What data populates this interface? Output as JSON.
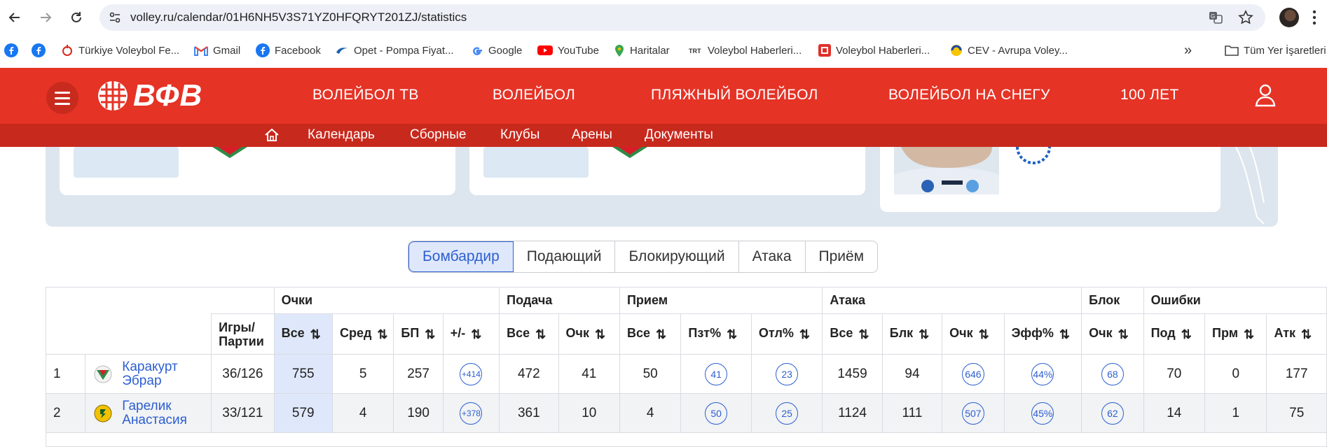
{
  "browser": {
    "url": "volley.ru/calendar/01H6NH5V3S71YZ0HFQRYT201ZJ/statistics",
    "bookmarks": [
      {
        "label": "",
        "icon": "facebook-icon"
      },
      {
        "label": "",
        "icon": "facebook-icon"
      },
      {
        "label": "Türkiye Voleybol Fe...",
        "icon": "tvf-icon"
      },
      {
        "label": "Gmail",
        "icon": "gmail-icon"
      },
      {
        "label": "Facebook",
        "icon": "facebook-icon"
      },
      {
        "label": "Opet - Pompa Fiyat...",
        "icon": "opet-icon"
      },
      {
        "label": "Google",
        "icon": "google-icon"
      },
      {
        "label": "YouTube",
        "icon": "youtube-icon"
      },
      {
        "label": "Haritalar",
        "icon": "maps-icon"
      },
      {
        "label": "Voleybol Haberleri...",
        "icon": "trt-icon"
      },
      {
        "label": "Voleybol Haberleri...",
        "icon": "news-icon"
      },
      {
        "label": "CEV - Avrupa Voley...",
        "icon": "cev-icon"
      }
    ],
    "overflow_label": "»",
    "all_bookmarks_label": "Tüm Yer İşaretleri"
  },
  "site": {
    "logo_text": "ВФВ",
    "nav": [
      "ВОЛЕЙБОЛ ТВ",
      "ВОЛЕЙБОЛ",
      "ПЛЯЖНЫЙ ВОЛЕЙБОЛ",
      "ВОЛЕЙБОЛ НА СНЕГУ",
      "100 ЛЕТ"
    ],
    "subnav": [
      "Календарь",
      "Сборные",
      "Клубы",
      "Арены",
      "Документы"
    ],
    "brand_color": "#e53326",
    "subnav_color": "#c8291d",
    "accent_color": "#2d5fd0"
  },
  "tabs": {
    "items": [
      "Бомбардир",
      "Подающий",
      "Блокирующий",
      "Атака",
      "Приём"
    ],
    "active": "Бомбардир"
  },
  "table": {
    "groups": {
      "points": "Очки",
      "serve": "Подача",
      "reception": "Прием",
      "attack": "Атака",
      "block": "Блок",
      "errors": "Ошибки"
    },
    "columns": {
      "games": "Игры/ Партии",
      "pts_all": "Все",
      "pts_avg": "Сред",
      "pts_bp": "БП",
      "pts_pm": "+/-",
      "srv_all": "Все",
      "srv_pts": "Очк",
      "rec_all": "Все",
      "rec_pos": "Пзт%",
      "rec_exc": "Отл%",
      "atk_all": "Все",
      "atk_blk": "Блк",
      "atk_pts": "Очк",
      "atk_eff": "Эфф%",
      "blk_pts": "Очк",
      "err_srv": "Под",
      "err_rec": "Прм",
      "err_atk": "Атк"
    },
    "rows": [
      {
        "rank": "1",
        "name": "Каракурт Эбрар",
        "club_icon": "lokomotiv-logo",
        "games": "36/126",
        "pts_all": "755",
        "pts_avg": "5",
        "pts_bp": "257",
        "pts_pm": "+414",
        "srv_all": "472",
        "srv_pts": "41",
        "rec_all": "50",
        "rec_pos": "41",
        "rec_exc": "23",
        "atk_all": "1459",
        "atk_blk": "94",
        "atk_pts": "646",
        "atk_eff": "44%",
        "blk_pts": "68",
        "err_srv": "70",
        "err_rec": "0",
        "err_atk": "177"
      },
      {
        "rank": "2",
        "name": "Гарелик Анастасия",
        "club_icon": "club-logo",
        "games": "33/121",
        "pts_all": "579",
        "pts_avg": "4",
        "pts_bp": "190",
        "pts_pm": "+378",
        "srv_all": "361",
        "srv_pts": "10",
        "rec_all": "4",
        "rec_pos": "50",
        "rec_exc": "25",
        "atk_all": "1124",
        "atk_blk": "111",
        "atk_pts": "507",
        "atk_eff": "45%",
        "blk_pts": "62",
        "err_srv": "14",
        "err_rec": "1",
        "err_atk": "75"
      }
    ]
  }
}
